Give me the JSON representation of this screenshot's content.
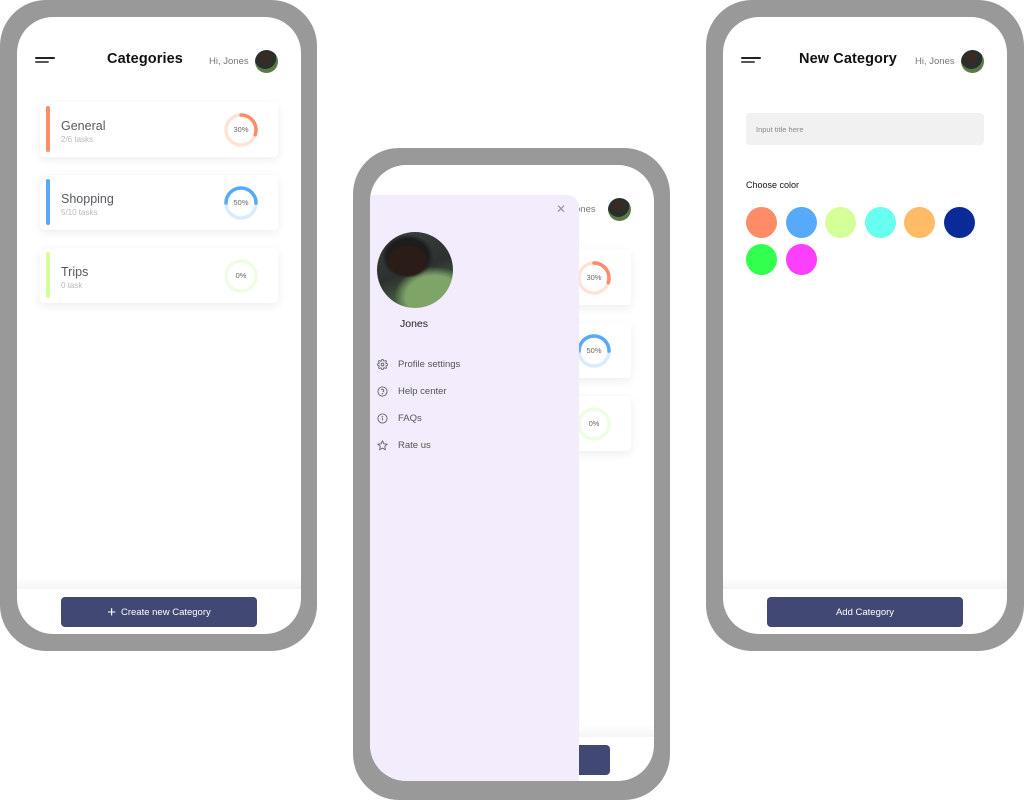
{
  "user": {
    "greeting": "Hi, Jones",
    "greeting_partial": "ones",
    "name": "Jones"
  },
  "colors": {
    "frame": "#999999",
    "button": "#424874",
    "drawer": "#f2ecfd"
  },
  "categories_screen": {
    "title": "Categories",
    "categories": [
      {
        "name": "General",
        "count": "2/6 tasks",
        "progress_percent": 30,
        "progress_label": "30%",
        "color": "#ff8c66",
        "track": "#ffe3d8"
      },
      {
        "name": "Shopping",
        "count": "5/10 tasks",
        "progress_percent": 50,
        "progress_label": "50%",
        "color": "#57a9f9",
        "track": "#d9ecff"
      },
      {
        "name": "Trips",
        "count": "0 task",
        "progress_percent": 0,
        "progress_label": "0%",
        "color": "#d4ff99",
        "track": "#effde4"
      }
    ],
    "create_button": {
      "icon": "plus-icon",
      "label": "Create new  Category"
    }
  },
  "drawer_screen": {
    "close_icon": "close-icon",
    "menu": [
      {
        "icon": "gear-icon",
        "label": "Profile settings"
      },
      {
        "icon": "help-circle-icon",
        "label": "Help center"
      },
      {
        "icon": "info-icon",
        "label": "FAQs"
      },
      {
        "icon": "star-icon",
        "label": "Rate us"
      }
    ]
  },
  "new_category_screen": {
    "title": "New Category",
    "title_input": {
      "placeholder": "Input title here",
      "value": ""
    },
    "choose_color_label": "Choose color",
    "swatches": [
      "#ff8c66",
      "#57a9f9",
      "#d4ff99",
      "#66fff0",
      "#ffbb66",
      "#0a2b97",
      "#33ff4e",
      "#fb3ffa"
    ],
    "add_button": {
      "label": "Add Category"
    }
  }
}
